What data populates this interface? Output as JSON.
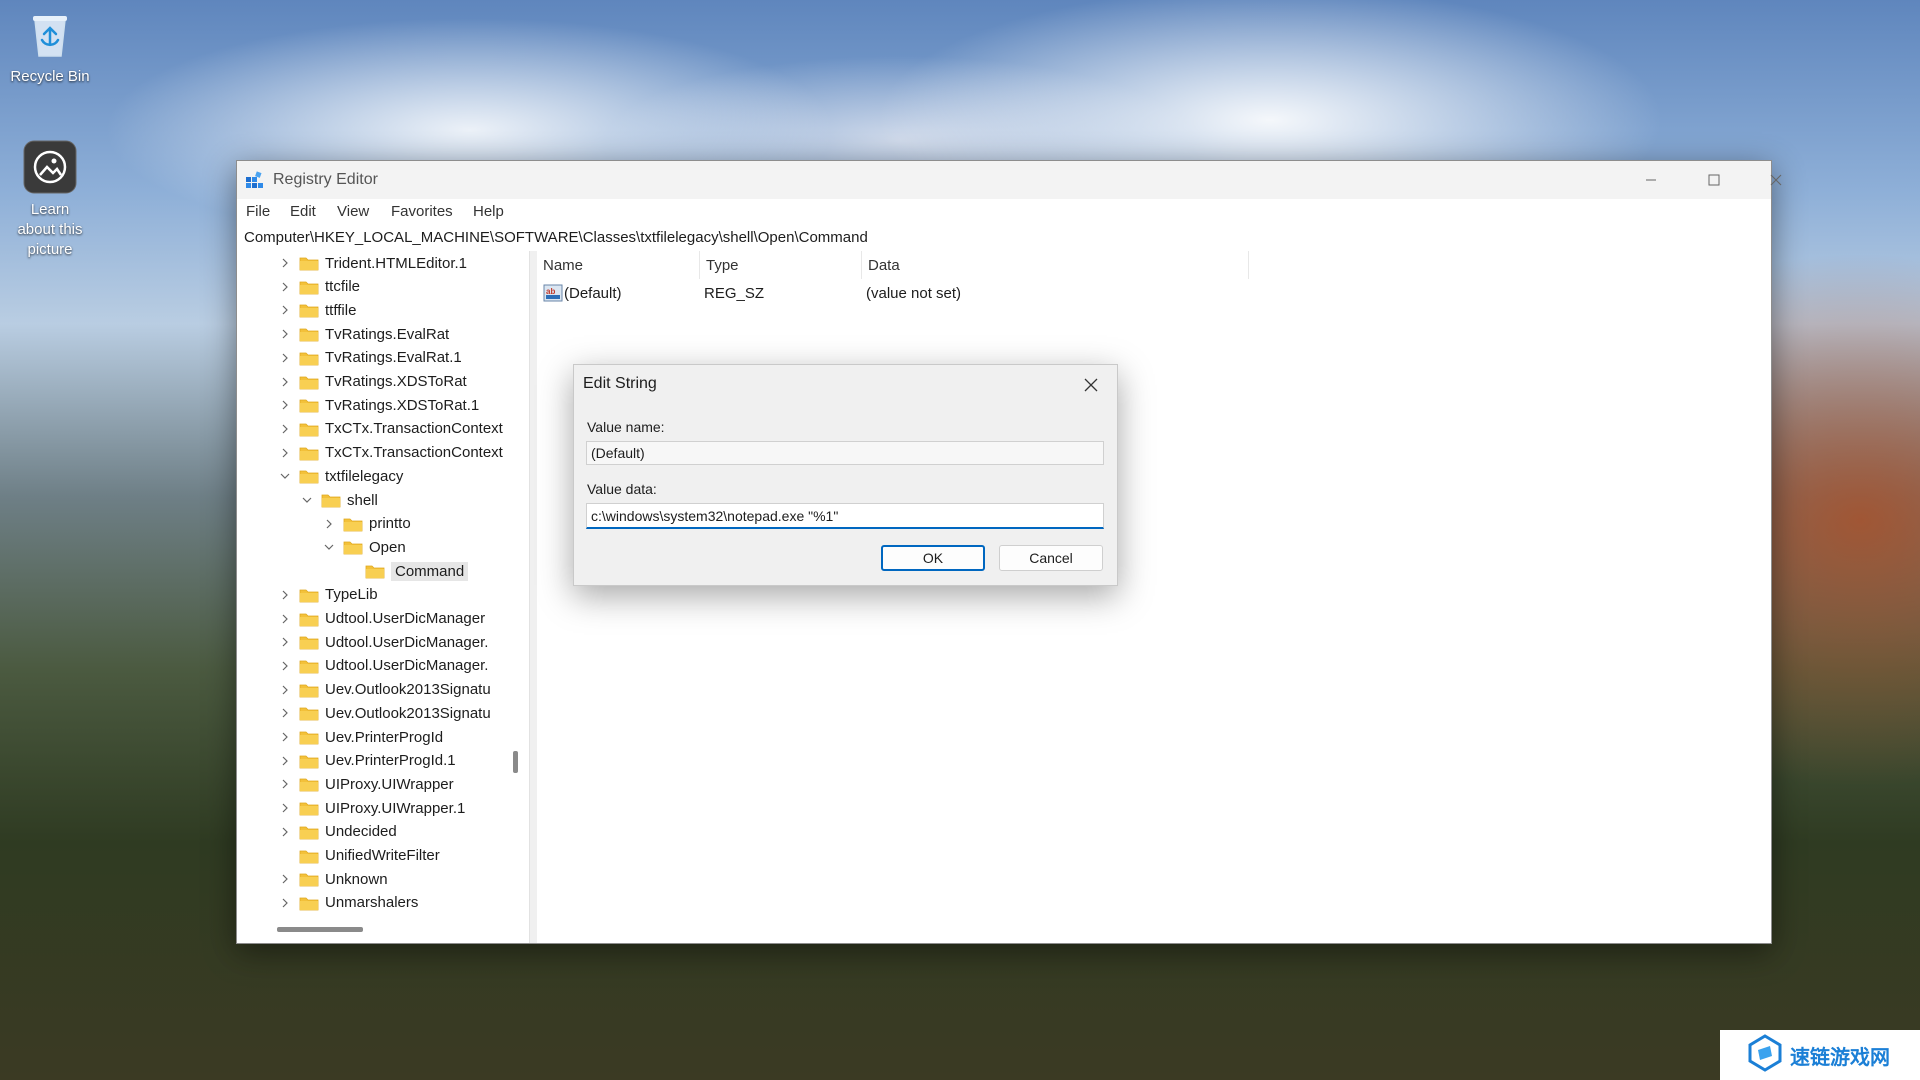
{
  "desktop": {
    "icons": [
      {
        "label": "Recycle Bin",
        "icon": "recycle-bin-icon"
      },
      {
        "label": "Learn about this picture",
        "icon": "camera-icon"
      }
    ]
  },
  "window": {
    "title": "Registry Editor",
    "menu": [
      "File",
      "Edit",
      "View",
      "Favorites",
      "Help"
    ],
    "address": "Computer\\HKEY_LOCAL_MACHINE\\SOFTWARE\\Classes\\txtfilelegacy\\shell\\Open\\Command"
  },
  "tree": {
    "items": [
      {
        "label": "Trident.HTMLEditor.1",
        "level": 0,
        "state": "collapsed"
      },
      {
        "label": "ttcfile",
        "level": 0,
        "state": "collapsed"
      },
      {
        "label": "ttffile",
        "level": 0,
        "state": "collapsed"
      },
      {
        "label": "TvRatings.EvalRat",
        "level": 0,
        "state": "collapsed"
      },
      {
        "label": "TvRatings.EvalRat.1",
        "level": 0,
        "state": "collapsed"
      },
      {
        "label": "TvRatings.XDSToRat",
        "level": 0,
        "state": "collapsed"
      },
      {
        "label": "TvRatings.XDSToRat.1",
        "level": 0,
        "state": "collapsed"
      },
      {
        "label": "TxCTx.TransactionContext",
        "level": 0,
        "state": "collapsed"
      },
      {
        "label": "TxCTx.TransactionContext",
        "level": 0,
        "state": "collapsed"
      },
      {
        "label": "txtfilelegacy",
        "level": 0,
        "state": "expanded"
      },
      {
        "label": "shell",
        "level": 1,
        "state": "expanded"
      },
      {
        "label": "printto",
        "level": 2,
        "state": "collapsed"
      },
      {
        "label": "Open",
        "level": 2,
        "state": "expanded"
      },
      {
        "label": "Command",
        "level": 3,
        "state": "leaf",
        "selected": true
      },
      {
        "label": "TypeLib",
        "level": 0,
        "state": "collapsed"
      },
      {
        "label": "Udtool.UserDicManager",
        "level": 0,
        "state": "collapsed"
      },
      {
        "label": "Udtool.UserDicManager.",
        "level": 0,
        "state": "collapsed"
      },
      {
        "label": "Udtool.UserDicManager.",
        "level": 0,
        "state": "collapsed"
      },
      {
        "label": "Uev.Outlook2013Signatu",
        "level": 0,
        "state": "collapsed"
      },
      {
        "label": "Uev.Outlook2013Signatu",
        "level": 0,
        "state": "collapsed"
      },
      {
        "label": "Uev.PrinterProgId",
        "level": 0,
        "state": "collapsed"
      },
      {
        "label": "Uev.PrinterProgId.1",
        "level": 0,
        "state": "collapsed"
      },
      {
        "label": "UIProxy.UIWrapper",
        "level": 0,
        "state": "collapsed"
      },
      {
        "label": "UIProxy.UIWrapper.1",
        "level": 0,
        "state": "collapsed"
      },
      {
        "label": "Undecided",
        "level": 0,
        "state": "collapsed"
      },
      {
        "label": "UnifiedWriteFilter",
        "level": 0,
        "state": "leaf"
      },
      {
        "label": "Unknown",
        "level": 0,
        "state": "collapsed"
      },
      {
        "label": "Unmarshalers",
        "level": 0,
        "state": "collapsed"
      }
    ]
  },
  "values": {
    "columns": [
      "Name",
      "Type",
      "Data"
    ],
    "rows": [
      {
        "name": "(Default)",
        "type": "REG_SZ",
        "data": "(value not set)"
      }
    ]
  },
  "dialog": {
    "title": "Edit String",
    "value_name_label": "Value name:",
    "value_name": "(Default)",
    "value_data_label": "Value data:",
    "value_data": "c:\\windows\\system32\\notepad.exe \"%1\"",
    "ok_label": "OK",
    "cancel_label": "Cancel"
  },
  "watermark": {
    "text": "速链游戏网"
  },
  "colors": {
    "accent": "#0067c0",
    "folder": "#f3c13a",
    "folder_dark": "#e0a81e"
  }
}
